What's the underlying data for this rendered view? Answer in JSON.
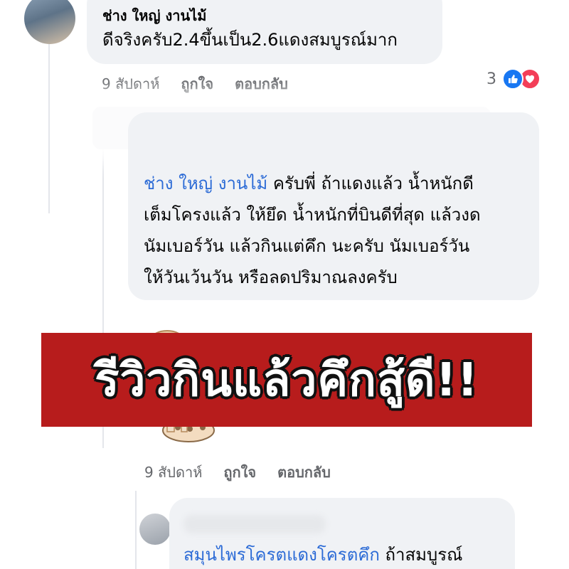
{
  "comment1": {
    "author": "ช่าง ใหญ่ งานไม้",
    "text": "ดีจริงครับ2.4ขึ้นเป็น2.6แดงสมบูรณ์มาก",
    "time": "9 สัปดาห์",
    "like": "ถูกใจ",
    "reply": "ตอบกลับ",
    "reaction_count": "3"
  },
  "comment2": {
    "mention": "ช่าง ใหญ่ งานไม้",
    "line1": "ครับพี่ ถ้าแดงแล้ว น้ำหนักดี",
    "line2": "เต็มโครงแล้ว ให้ยึด น้ำหนักที่บินดีที่สุด แล้วงด",
    "line3": "นัมเบอร์วัน แล้วกินแต่คึก นะครับ นัมเบอร์วัน",
    "line4": "ให้วันเว้นวัน หรือลดปริมาณลงครับ"
  },
  "banner": {
    "text": "รีวิวกินแล้วคึกสู้ดี!!"
  },
  "comment3": {
    "time": "9 สัปดาห์",
    "like": "ถูกใจ",
    "reply": "ตอบกลับ"
  },
  "comment4": {
    "mention": "สมุนไพรโครตแดงโครตคึก",
    "text": "ถ้าสมบูรณ์"
  },
  "colors": {
    "accent": "#1877f2",
    "love": "#f33e58",
    "banner": "#b71c1c",
    "mention": "#2c6bd6"
  },
  "icons": {
    "like": "thumbs-up-icon",
    "love": "heart-icon"
  }
}
